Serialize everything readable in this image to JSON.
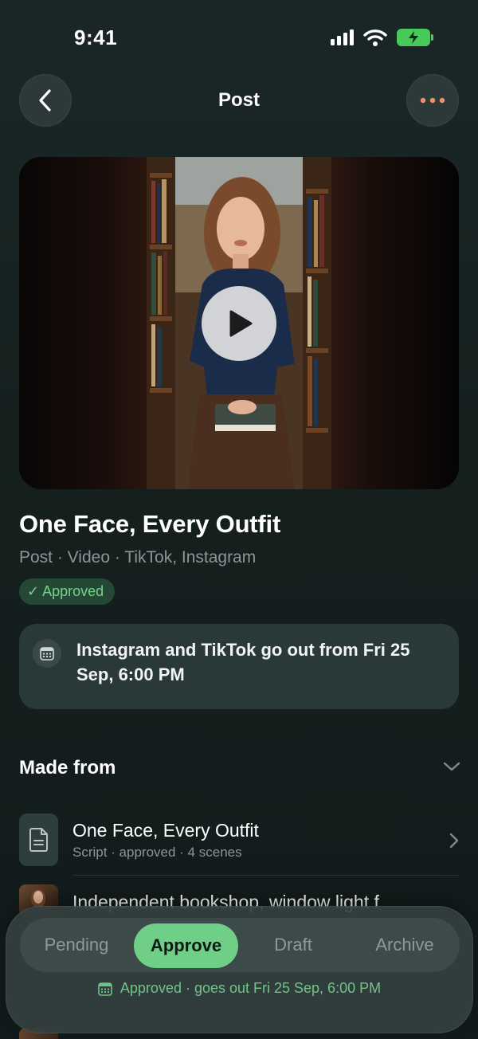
{
  "status_bar": {
    "time": "9:41"
  },
  "header": {
    "title": "Post",
    "back_icon": "chevron-left-icon",
    "more_icon": "more-horizontal-icon"
  },
  "media": {
    "type": "video",
    "play_icon": "play-icon"
  },
  "post": {
    "title": "One Face, Every Outfit",
    "meta": "Post · Video · TikTok, Instagram",
    "status_badge": "✓ Approved"
  },
  "schedule": {
    "icon": "calendar-icon",
    "text": "Instagram and TikTok go out from Fri 25 Sep, 6:00 PM"
  },
  "made_from": {
    "header": "Made from",
    "items": [
      {
        "title": "One Face, Every Outfit",
        "subtitle": "Script · approved · 4 scenes",
        "icon": "document-icon"
      },
      {
        "title": "Independent bookshop, window light f",
        "icon": "photo-thumbnail"
      }
    ]
  },
  "action_panel": {
    "segments": [
      "Pending",
      "Approve",
      "Draft",
      "Archive"
    ],
    "selected": "Approve",
    "status_text": "Approved · goes out Fri 25 Sep, 6:00 PM"
  },
  "colors": {
    "accent_green": "#6fcf86",
    "more_dots": "#f0906a",
    "background": "#15201f"
  }
}
